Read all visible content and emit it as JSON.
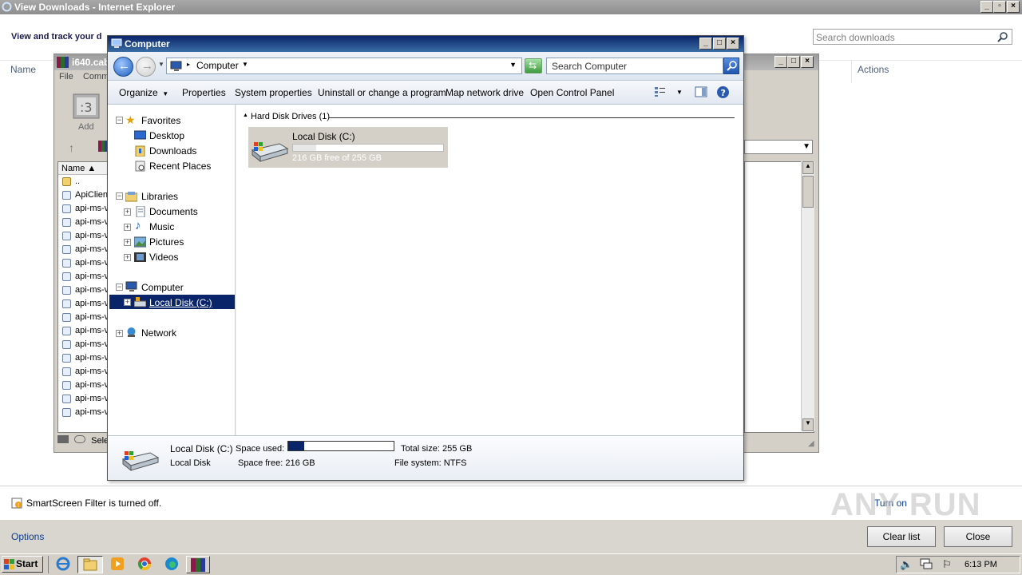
{
  "ie": {
    "title": "View Downloads - Internet Explorer",
    "header_text": "View and track your d",
    "search_placeholder": "Search downloads",
    "col_name": "Name",
    "col_actions": "Actions",
    "smartscreen_text": "SmartScreen Filter is turned off.",
    "turn_on": "Turn on",
    "options": "Options",
    "clear_list": "Clear list",
    "close": "Close"
  },
  "archive": {
    "title": "i640.cab",
    "menu": [
      "File",
      "Comm"
    ],
    "add_label": "Add",
    "list_header": "Name",
    "rows": [
      "..",
      "ApiClient",
      "api-ms-v",
      "api-ms-v",
      "api-ms-v",
      "api-ms-v",
      "api-ms-v",
      "api-ms-v",
      "api-ms-v",
      "api-ms-v",
      "api-ms-v",
      "api-ms-v",
      "api-ms-v",
      "api-ms-v",
      "api-ms-v",
      "api-ms-v",
      "api-ms-v",
      "api-ms-v"
    ],
    "status": "Sele"
  },
  "explorer": {
    "title": "Computer",
    "address": "Computer",
    "search_placeholder": "Search Computer",
    "toolbar": [
      "Organize",
      "Properties",
      "System properties",
      "Uninstall or change a program",
      "Map network drive",
      "Open Control Panel"
    ],
    "nav": {
      "favorites": "Favorites",
      "desktop": "Desktop",
      "downloads": "Downloads",
      "recent": "Recent Places",
      "libraries": "Libraries",
      "documents": "Documents",
      "music": "Music",
      "pictures": "Pictures",
      "videos": "Videos",
      "computer": "Computer",
      "local_disk": "Local Disk (C:)",
      "network": "Network"
    },
    "group_header": "Hard Disk Drives (1)",
    "drive": {
      "name": "Local Disk (C:)",
      "free_text": "216 GB free of 255 GB",
      "used_fraction": 0.153
    },
    "details": {
      "name": "Local Disk (C:)",
      "type": "Local Disk",
      "space_used_label": "Space used:",
      "space_free_label": "Space free:",
      "space_free_value": "216 GB",
      "total_size_label": "Total size:",
      "total_size_value": "255 GB",
      "fs_label": "File system:",
      "fs_value": "NTFS"
    }
  },
  "taskbar": {
    "start": "Start",
    "clock": "6:13 PM"
  },
  "watermark": "ANY RUN",
  "colors": {
    "title_active": "#0a246a",
    "selection": "#0a246a",
    "link": "#0b3d91"
  }
}
